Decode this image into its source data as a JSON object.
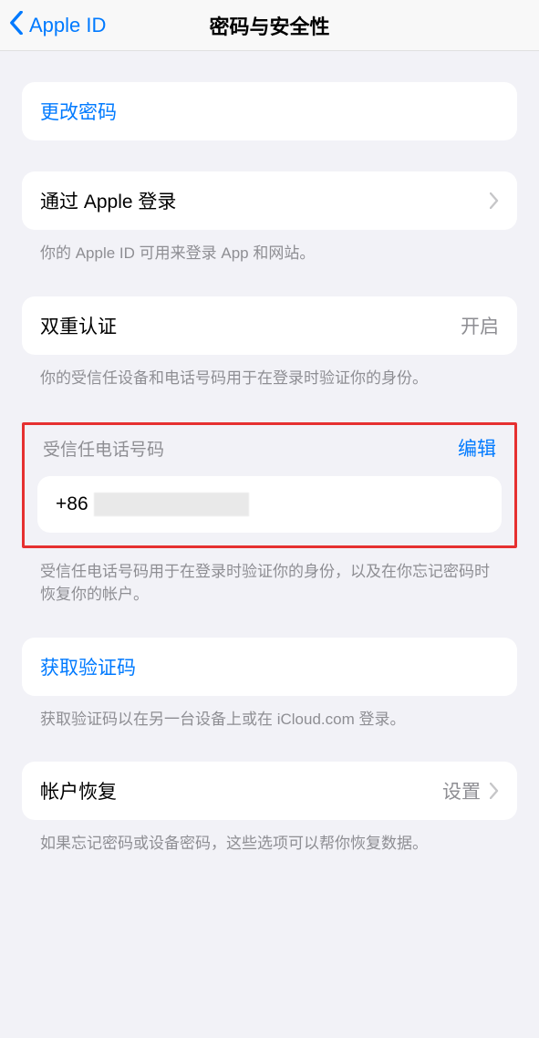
{
  "nav": {
    "back_label": "Apple ID",
    "title": "密码与安全性"
  },
  "change_password": {
    "label": "更改密码"
  },
  "signin_with_apple": {
    "label": "通过 Apple 登录",
    "note": "你的 Apple ID 可用来登录 App 和网站。"
  },
  "two_factor": {
    "label": "双重认证",
    "value": "开启",
    "note": "你的受信任设备和电话号码用于在登录时验证你的身份。"
  },
  "trusted_phone": {
    "header": "受信任电话号码",
    "edit": "编辑",
    "prefix": "+86",
    "note": "受信任电话号码用于在登录时验证你的身份，以及在你忘记密码时恢复你的帐户。"
  },
  "get_code": {
    "label": "获取验证码",
    "note": "获取验证码以在另一台设备上或在 iCloud.com 登录。"
  },
  "account_recovery": {
    "label": "帐户恢复",
    "value": "设置",
    "note": "如果忘记密码或设备密码，这些选项可以帮你恢复数据。"
  }
}
